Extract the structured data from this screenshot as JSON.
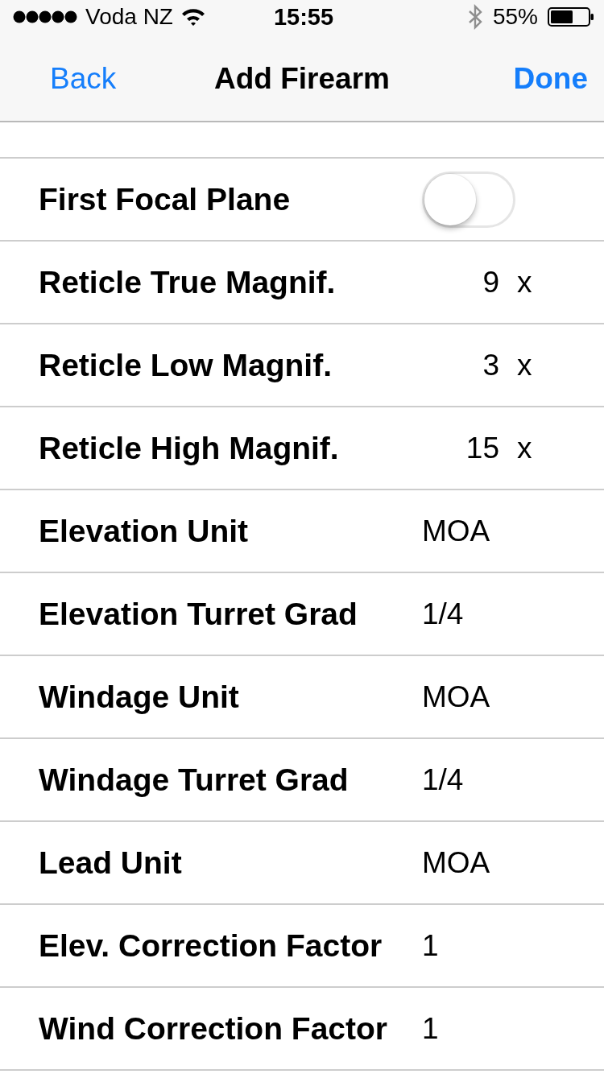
{
  "status_bar": {
    "carrier": "Voda NZ",
    "time": "15:55",
    "battery": "55%"
  },
  "nav_bar": {
    "back": "Back",
    "title": "Add Firearm",
    "done": "Done"
  },
  "rows": [
    {
      "kind": "toggle",
      "label": "First Focal Plane",
      "on": false
    },
    {
      "kind": "magnification",
      "label": "Reticle True Magnif.",
      "value": "9",
      "unit": "x"
    },
    {
      "kind": "magnification",
      "label": "Reticle Low Magnif.",
      "value": "3",
      "unit": "x"
    },
    {
      "kind": "magnification",
      "label": "Reticle High Magnif.",
      "value": "15",
      "unit": "x"
    },
    {
      "kind": "text",
      "label": "Elevation Unit",
      "value": "MOA"
    },
    {
      "kind": "text",
      "label": "Elevation Turret Grad",
      "value": "1/4"
    },
    {
      "kind": "text",
      "label": "Windage Unit",
      "value": "MOA"
    },
    {
      "kind": "text",
      "label": "Windage Turret Grad",
      "value": "1/4"
    },
    {
      "kind": "text",
      "label": "Lead Unit",
      "value": "MOA"
    },
    {
      "kind": "text",
      "label": "Elev. Correction Factor",
      "value": "1"
    },
    {
      "kind": "text",
      "label": "Wind Correction Factor",
      "value": "1"
    }
  ]
}
